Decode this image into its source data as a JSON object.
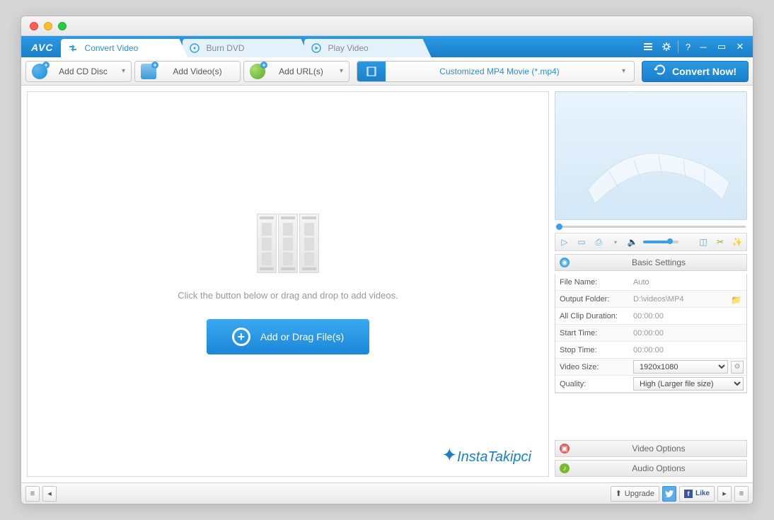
{
  "logo": "AVC",
  "tabs": [
    {
      "label": "Convert Video",
      "active": true
    },
    {
      "label": "Burn DVD",
      "active": false
    },
    {
      "label": "Play Video",
      "active": false
    }
  ],
  "toolbar": {
    "add_cd": "Add CD Disc",
    "add_videos": "Add Video(s)",
    "add_urls": "Add URL(s)",
    "profile": "Customized MP4 Movie (*.mp4)",
    "convert": "Convert Now!"
  },
  "dropzone": {
    "hint": "Click the button below or drag and drop to add videos.",
    "button": "Add or Drag File(s)"
  },
  "watermark": "InstaTakipci",
  "settings": {
    "basic_header": "Basic Settings",
    "rows": {
      "file_name": {
        "k": "File Name:",
        "v": "Auto"
      },
      "output_folder": {
        "k": "Output Folder:",
        "v": "D:\\videos\\MP4"
      },
      "clip_duration": {
        "k": "All Clip Duration:",
        "v": "00:00:00"
      },
      "start_time": {
        "k": "Start Time:",
        "v": "00:00:00"
      },
      "stop_time": {
        "k": "Stop Time:",
        "v": "00:00:00"
      },
      "video_size": {
        "k": "Video Size:",
        "v": "1920x1080"
      },
      "quality": {
        "k": "Quality:",
        "v": "High (Larger file size)"
      }
    },
    "video_header": "Video Options",
    "audio_header": "Audio Options"
  },
  "statusbar": {
    "upgrade": "Upgrade",
    "like": "Like"
  }
}
